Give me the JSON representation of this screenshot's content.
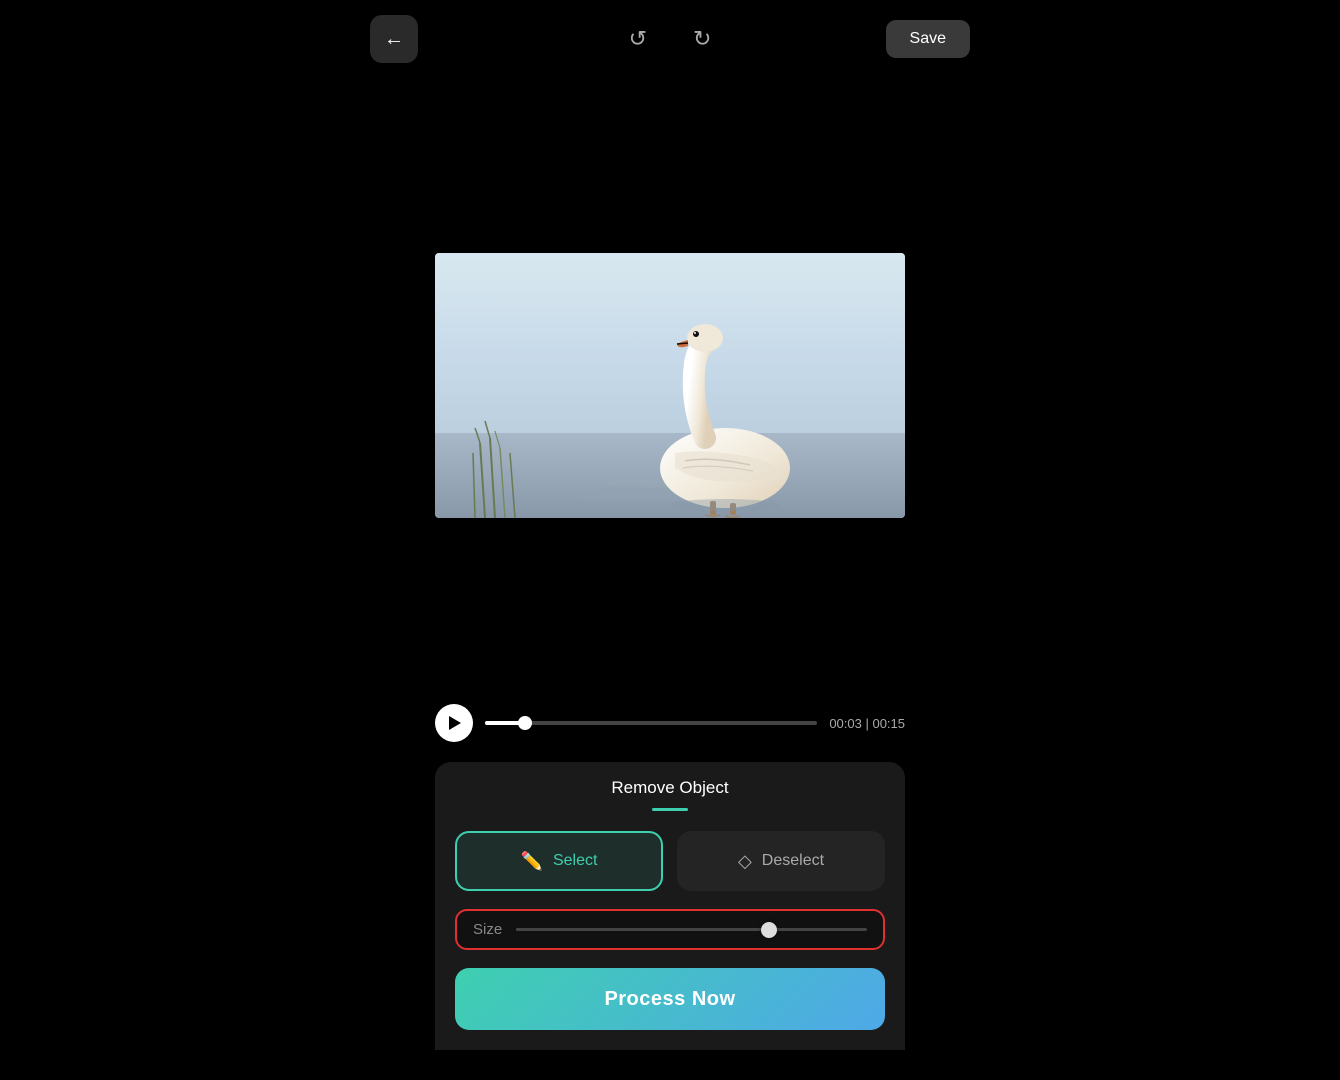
{
  "toolbar": {
    "back_label": "←",
    "undo_label": "↺",
    "redo_label": "↻",
    "save_label": "Save"
  },
  "timeline": {
    "current_time": "00:03",
    "total_time": "00:15",
    "time_display": "00:03 | 00:15",
    "progress_percent": 12
  },
  "panel": {
    "title": "Remove Object",
    "select_label": "Select",
    "deselect_label": "Deselect",
    "size_label": "Size",
    "process_label": "Process Now",
    "slider_percent": 72
  }
}
